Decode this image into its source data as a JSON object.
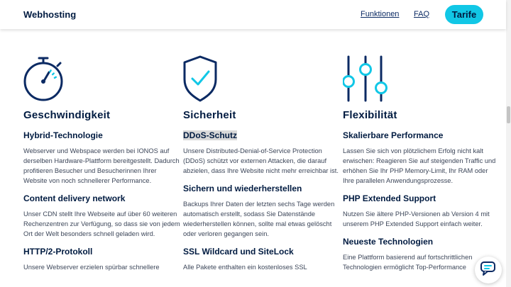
{
  "header": {
    "brand": "Webhosting",
    "nav": {
      "funktionen": "Funktionen",
      "faq": "FAQ"
    },
    "cta": "Tarife"
  },
  "colors": {
    "accent": "#11c7e6",
    "text_dark": "#001b41",
    "icon_blue": "#0b2a63"
  },
  "columns": [
    {
      "icon": "stopwatch-icon",
      "title": "Geschwindigkeit",
      "features": [
        {
          "title": "Hybrid-Technologie",
          "text": "Webserver und Webspace werden bei IONOS auf derselben Hardware-Plattform bereitgestellt. Dadurch profitieren Besucher und Besucherinnen Ihrer Website von noch schnellerer Performance."
        },
        {
          "title": "Content delivery network",
          "text": "Unser CDN stellt Ihre Webseite auf über 60 weiteren Rechenzentren zur Verfügung, so dass sie von jedem Ort der Welt besonders schnell geladen wird."
        },
        {
          "title": "HTTP/2-Protokoll",
          "text": "Unsere Webserver erzielen spürbar schnellere"
        }
      ]
    },
    {
      "icon": "shield-check-icon",
      "title": "Sicherheit",
      "features": [
        {
          "title": "DDoS-Schutz",
          "text": "Unsere Distributed-Denial-of-Service Protection (DDoS) schützt vor externen Attacken, die darauf abzielen, dass Ihre Website nicht mehr erreichbar ist."
        },
        {
          "title": "Sichern und wiederherstellen",
          "text": "Backups Ihrer Daten der letzten sechs Tage werden automatisch erstellt, sodass Sie Datenstände wiederherstellen können, sollte mal etwas gelöscht oder verloren gegangen sein."
        },
        {
          "title": "SSL Wildcard und SiteLock",
          "text": "Alle Pakete enthalten ein kostenloses SSL"
        }
      ]
    },
    {
      "icon": "sliders-icon",
      "title": "Flexibilität",
      "features": [
        {
          "title": "Skalierbare Performance",
          "text": "Lassen Sie sich von plötzlichem Erfolg nicht kalt erwischen: Reagieren Sie auf steigenden Traffic und erhöhen Sie Ihr PHP Memory-Limit, Ihr RAM oder Ihre parallelen Anwendungsprozesse."
        },
        {
          "title": "PHP Extended Support",
          "text": "Nutzen Sie ältere PHP-Versionen ab Version 4 mit unserem PHP Extended Support einfach weiter."
        },
        {
          "title": "Neueste Technologien",
          "text": "Eine Plattform basierend auf fortschrittlichen Technologien ermöglicht Top-Performance"
        }
      ]
    }
  ],
  "chat": {
    "icon": "chat-icon"
  }
}
